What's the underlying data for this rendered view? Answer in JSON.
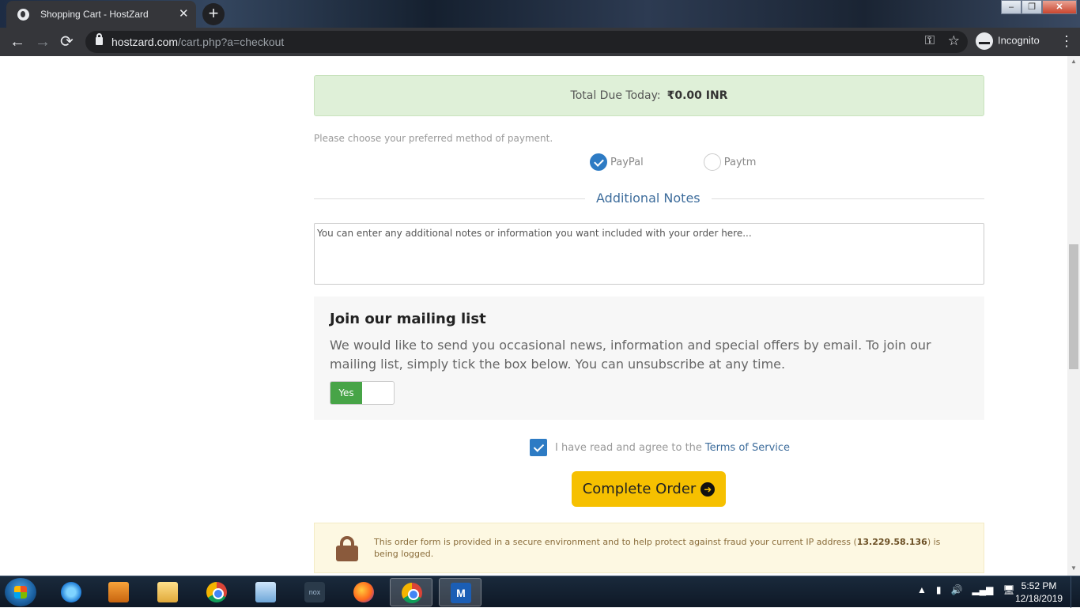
{
  "browser": {
    "tab_title": "Shopping Cart - HostZard",
    "tab_close": "✕",
    "new_tab": "+",
    "url_domain": "hostzard.com",
    "url_path": "/cart.php?a=checkout",
    "profile_label": "Incognito",
    "nav_back": "←",
    "nav_forward": "→",
    "nav_reload": "⟳",
    "key_glyph": "⚿",
    "star_glyph": "☆",
    "menu_glyph": "⋮",
    "win_min": "–",
    "win_max": "❐",
    "win_close": "✕"
  },
  "checkout": {
    "total_label": "Total Due Today:",
    "total_value": "₹0.00 INR",
    "payment_prompt": "Please choose your preferred method of payment.",
    "payment_methods": [
      {
        "label": "PayPal",
        "selected": true
      },
      {
        "label": "Paytm",
        "selected": false
      }
    ],
    "notes_heading": "Additional Notes",
    "notes_placeholder": "You can enter any additional notes or information you want included with your order here..."
  },
  "mailing_list": {
    "title": "Join our mailing list",
    "description": "We would like to send you occasional news, information and special offers by email. To join our mailing list, simply tick the box below. You can unsubscribe at any time.",
    "toggle_label": "Yes",
    "toggle_on": true
  },
  "terms": {
    "checked": true,
    "prefix": "I have read and agree to the",
    "link_text": "Terms of Service"
  },
  "complete_button": {
    "label": "Complete Order",
    "color": "#f6c000"
  },
  "security_notice": {
    "text_before": "This order form is provided in a secure environment and to help protect against fraud your current IP address (",
    "ip": "13.229.58.136",
    "text_after": ") is being logged."
  },
  "taskbar": {
    "apps": [
      {
        "name": "internet-explorer-icon",
        "active": false
      },
      {
        "name": "media-player-icon",
        "active": false
      },
      {
        "name": "file-explorer-icon",
        "active": false
      },
      {
        "name": "chrome-icon",
        "active": false
      },
      {
        "name": "notepad-icon",
        "active": false
      },
      {
        "name": "nox-icon",
        "active": false
      },
      {
        "name": "firefox-icon",
        "active": false
      },
      {
        "name": "chrome-icon",
        "active": true
      },
      {
        "name": "malwarebytes-icon",
        "active": true
      }
    ],
    "nox_text": "nox",
    "tray_up": "▲",
    "tray_battery": "▮",
    "tray_volume": "🔊",
    "tray_signal": "▂▄▆",
    "tray_network": "🖥",
    "time": "5:52 PM",
    "date": "12/18/2019"
  },
  "colors": {
    "accent_blue": "#2d7bc4",
    "success_green": "#dff0d8",
    "toggle_green": "#47a447",
    "link_blue": "#3e6d9c"
  }
}
